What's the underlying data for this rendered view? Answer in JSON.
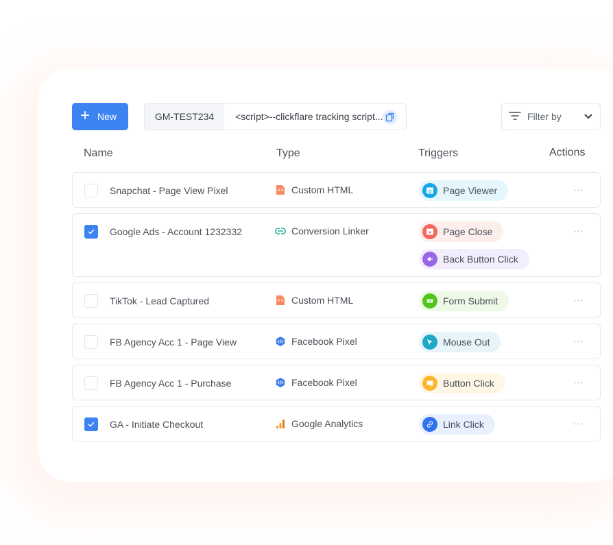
{
  "toolbar": {
    "new_label": "New",
    "container_id": "GM-TEST234",
    "script_snippet": "<script>--clickflare tracking script...",
    "filter_label": "Filter by"
  },
  "table": {
    "headers": {
      "name": "Name",
      "type": "Type",
      "triggers": "Triggers",
      "actions": "Actions"
    },
    "rows": [
      {
        "name": "Snapchat - Page View Pixel",
        "checked": false,
        "type": "Custom HTML",
        "type_icon": "custom-html-icon",
        "triggers": [
          {
            "label": "Page Viewer",
            "icon": "page-view-icon",
            "color": "#17a6e8",
            "bg": "#e6f6fd"
          }
        ]
      },
      {
        "name": "Google Ads - Account 1232332",
        "checked": true,
        "type": "Conversion Linker",
        "type_icon": "link-icon",
        "triggers": [
          {
            "label": "Page Close",
            "icon": "page-close-icon",
            "color": "#f2685a",
            "bg": "#fdeeec"
          },
          {
            "label": "Back Button Click",
            "icon": "back-arrow-icon",
            "color": "#9a66e8",
            "bg": "#f3eefd"
          }
        ]
      },
      {
        "name": "TikTok - Lead Captured",
        "checked": false,
        "type": "Custom HTML",
        "type_icon": "custom-html-icon",
        "triggers": [
          {
            "label": "Form Submit",
            "icon": "form-icon",
            "color": "#52c41a",
            "bg": "#eef9e8"
          }
        ]
      },
      {
        "name": "FB Agency Acc 1 - Page View",
        "checked": false,
        "type": "Facebook Pixel",
        "type_icon": "code-hex-icon",
        "triggers": [
          {
            "label": "Mouse Out",
            "icon": "cursor-icon",
            "color": "#20a9c7",
            "bg": "#e7f5fa"
          }
        ]
      },
      {
        "name": "FB Agency Acc 1 - Purchase",
        "checked": false,
        "type": "Facebook Pixel",
        "type_icon": "code-hex-icon",
        "triggers": [
          {
            "label": "Button Click",
            "icon": "button-click-icon",
            "color": "#fbb62c",
            "bg": "#fff6e6"
          }
        ]
      },
      {
        "name": "GA - Initiate Checkout",
        "checked": true,
        "type": "Google Analytics",
        "type_icon": "analytics-icon",
        "triggers": [
          {
            "label": "Link Click",
            "icon": "link-click-icon",
            "color": "#2f72ea",
            "bg": "#e9f0fd"
          }
        ]
      }
    ]
  },
  "colors": {
    "primary": "#3d83f2",
    "custom_html": "#f78a5f",
    "conversion_linker": "#20b89a",
    "facebook_pixel": "#3f7de8",
    "analytics_orange": "#f29c1f"
  }
}
